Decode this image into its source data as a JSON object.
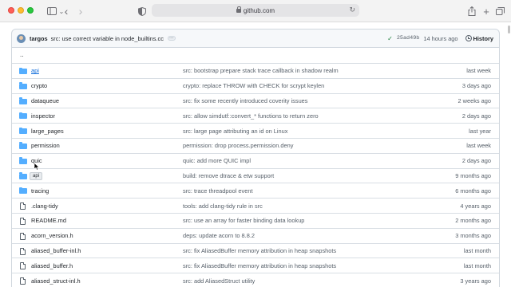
{
  "browser": {
    "url": "github.com"
  },
  "commit": {
    "author": "targos",
    "message": "src: use correct variable in node_builtins.cc",
    "sha": "25ad49b",
    "time": "14 hours ago",
    "history_label": "History"
  },
  "parent_dir": "..",
  "tooltip": "api",
  "files": [
    {
      "name": "api",
      "type": "folder",
      "message": "src: bootstrap prepare stack trace callback in shadow realm",
      "date": "last week"
    },
    {
      "name": "crypto",
      "type": "folder",
      "message": "crypto: replace THROW with CHECK for scrypt keylen",
      "date": "3 days ago"
    },
    {
      "name": "dataqueue",
      "type": "folder",
      "message": "src: fix some recently introduced coverity issues",
      "date": "2 weeks ago"
    },
    {
      "name": "inspector",
      "type": "folder",
      "message": "src: allow simdutf::convert_* functions to return zero",
      "date": "2 days ago"
    },
    {
      "name": "large_pages",
      "type": "folder",
      "message": "src: large page attributing an id on Linux",
      "date": "last year"
    },
    {
      "name": "permission",
      "type": "folder",
      "message": "permission: drop process.permission.deny",
      "date": "last week"
    },
    {
      "name": "quic",
      "type": "folder",
      "message": "quic: add more QUIC impl",
      "date": "2 days ago"
    },
    {
      "name": "r",
      "type": "folder",
      "message": "build: remove dtrace & etw support",
      "date": "9 months ago"
    },
    {
      "name": "tracing",
      "type": "folder",
      "message": "src: trace threadpool event",
      "date": "6 months ago"
    },
    {
      "name": ".clang-tidy",
      "type": "file",
      "message": "tools: add clang-tidy rule in src",
      "date": "4 years ago"
    },
    {
      "name": "README.md",
      "type": "file",
      "message": "src: use an array for faster binding data lookup",
      "date": "2 months ago"
    },
    {
      "name": "acorn_version.h",
      "type": "file",
      "message": "deps: update acorn to 8.8.2",
      "date": "3 months ago"
    },
    {
      "name": "aliased_buffer-inl.h",
      "type": "file",
      "message": "src: fix AliasedBuffer memory attribution in heap snapshots",
      "date": "last month"
    },
    {
      "name": "aliased_buffer.h",
      "type": "file",
      "message": "src: fix AliasedBuffer memory attribution in heap snapshots",
      "date": "last month"
    },
    {
      "name": "aliased_struct-inl.h",
      "type": "file",
      "message": "src: add AliasedStruct utility",
      "date": "3 years ago"
    }
  ]
}
